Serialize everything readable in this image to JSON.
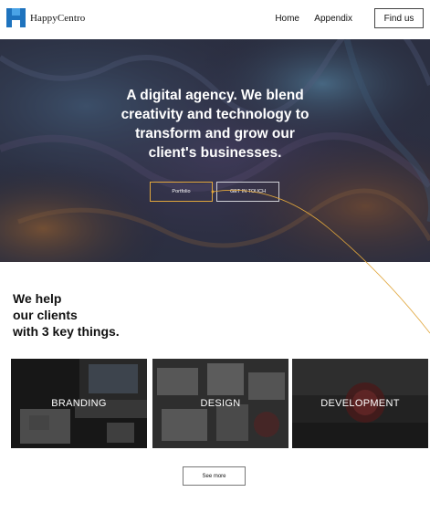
{
  "header": {
    "logo_text": "HappyCentro",
    "nav": {
      "home": "Home",
      "appendix": "Appendix",
      "find_us": "Find us"
    }
  },
  "hero": {
    "title": "A digital agency. We blend creativity and technology to transform and grow our client's businesses.",
    "buttons": {
      "portfolio": "Portfolio",
      "get_in_touch": "GET IN TOUCH"
    }
  },
  "services": {
    "heading_lines": [
      "We help",
      "our clients",
      "with 3 key things."
    ],
    "cards": [
      {
        "label": "BRANDING"
      },
      {
        "label": "DESIGN"
      },
      {
        "label": "DEVELOPMENT"
      }
    ],
    "see_more": "See more"
  },
  "colors": {
    "accent": "#e0a63c",
    "logo": "#1e73be"
  }
}
